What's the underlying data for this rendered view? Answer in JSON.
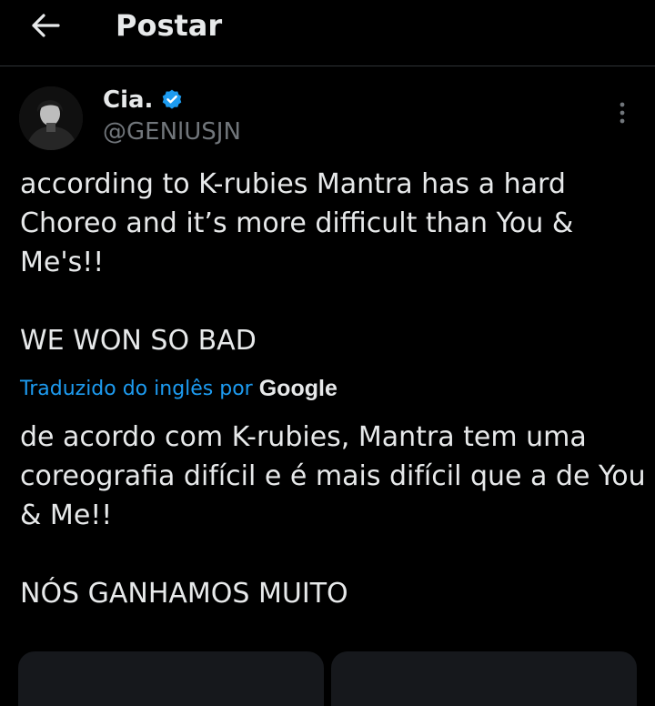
{
  "header": {
    "title": "Postar",
    "back_icon": "arrow-left-icon"
  },
  "author": {
    "display_name": "Cia.",
    "handle": "@GENlUSJN",
    "verified_icon": "verified-badge-icon",
    "verified_color": "#1d9bf0"
  },
  "post": {
    "text": "according to K-rubies Mantra has a hard\nChoreo and it’s more difficult than You &\nMe's!!\n\nWE WON SO BAD",
    "translation_label": "Traduzido do inglês por",
    "translation_provider": "Google",
    "translated_text": "de acordo com K-rubies, Mantra tem uma\ncoreografia difícil e é mais difícil que a de You\n& Me!!\n\nNÓS GANHAMOS MUITO"
  },
  "colors": {
    "background": "#000000",
    "text_primary": "#e7e9ea",
    "text_secondary": "#71767b",
    "accent": "#1d9bf0",
    "divider": "#2f3336"
  }
}
